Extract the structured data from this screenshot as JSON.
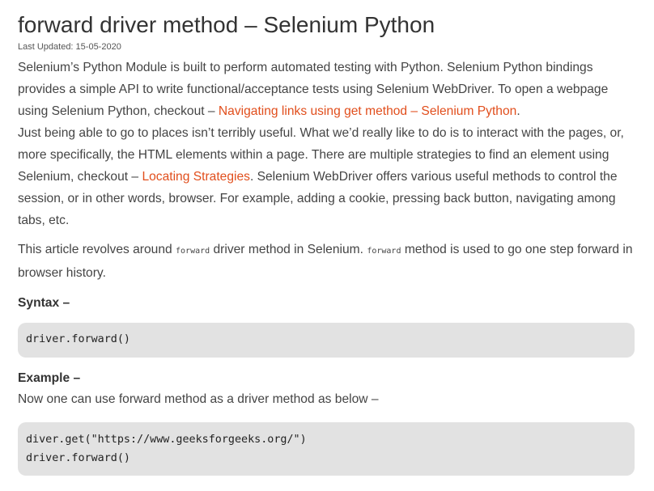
{
  "article": {
    "title": "forward driver method – Selenium Python",
    "last_updated": "Last Updated: 15-05-2020",
    "intro": {
      "text_1": "Selenium’s Python Module is built to perform automated testing with Python. Selenium Python bindings provides a simple API to write functional/acceptance tests using Selenium WebDriver. To open a webpage using Selenium Python, checkout – ",
      "link_1": "Navigating links using get method – Selenium Python",
      "text_2": ".",
      "text_3": "Just being able to go to places isn’t terribly useful. What we’d really like to do is to interact with the pages, or, more specifically, the HTML elements within a page. There are multiple strategies to find an element using Selenium, checkout – ",
      "link_2": "Locating Strategies",
      "text_4": ". Selenium WebDriver offers various useful methods to control the session, or in other words, browser. For example, adding a cookie, pressing back button, navigating among tabs, etc."
    },
    "article_para": {
      "text_1": "This article revolves around ",
      "code_1": "forward",
      "text_2": " driver method in Selenium. ",
      "code_2": "forward",
      "text_3": " method is used to go one step forward in browser history."
    },
    "syntax": {
      "heading": "Syntax –",
      "code": "driver.forward()"
    },
    "example": {
      "heading": "Example –",
      "description": "Now one can use forward method as a driver method as below –",
      "code_lines": [
        "diver.get(\"https://www.geeksforgeeks.org/\")",
        "driver.forward()"
      ]
    }
  },
  "colors": {
    "link": "#e14e1c",
    "text": "#444444",
    "code_background": "#e2e2e2"
  }
}
